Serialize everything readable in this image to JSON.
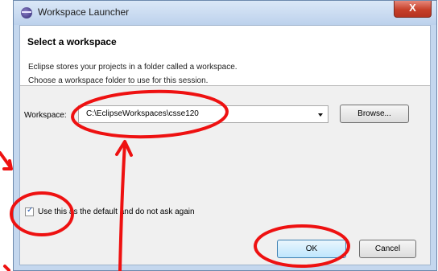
{
  "window": {
    "title": "Workspace Launcher",
    "close_label": "X"
  },
  "header": {
    "title": "Select a workspace",
    "line1": "Eclipse stores your projects in a folder called a workspace.",
    "line2": "Choose a workspace folder to use for this session."
  },
  "workspace": {
    "label": "Workspace:",
    "value": "C:\\EclipseWorkspaces\\csse120",
    "browse_label": "Browse..."
  },
  "default_checkbox": {
    "label": "Use this as the default and do not ask again",
    "checked": true,
    "check_glyph": "✓"
  },
  "buttons": {
    "ok_label": "OK",
    "cancel_label": "Cancel"
  },
  "annotation": {
    "color": "#ee1111"
  }
}
